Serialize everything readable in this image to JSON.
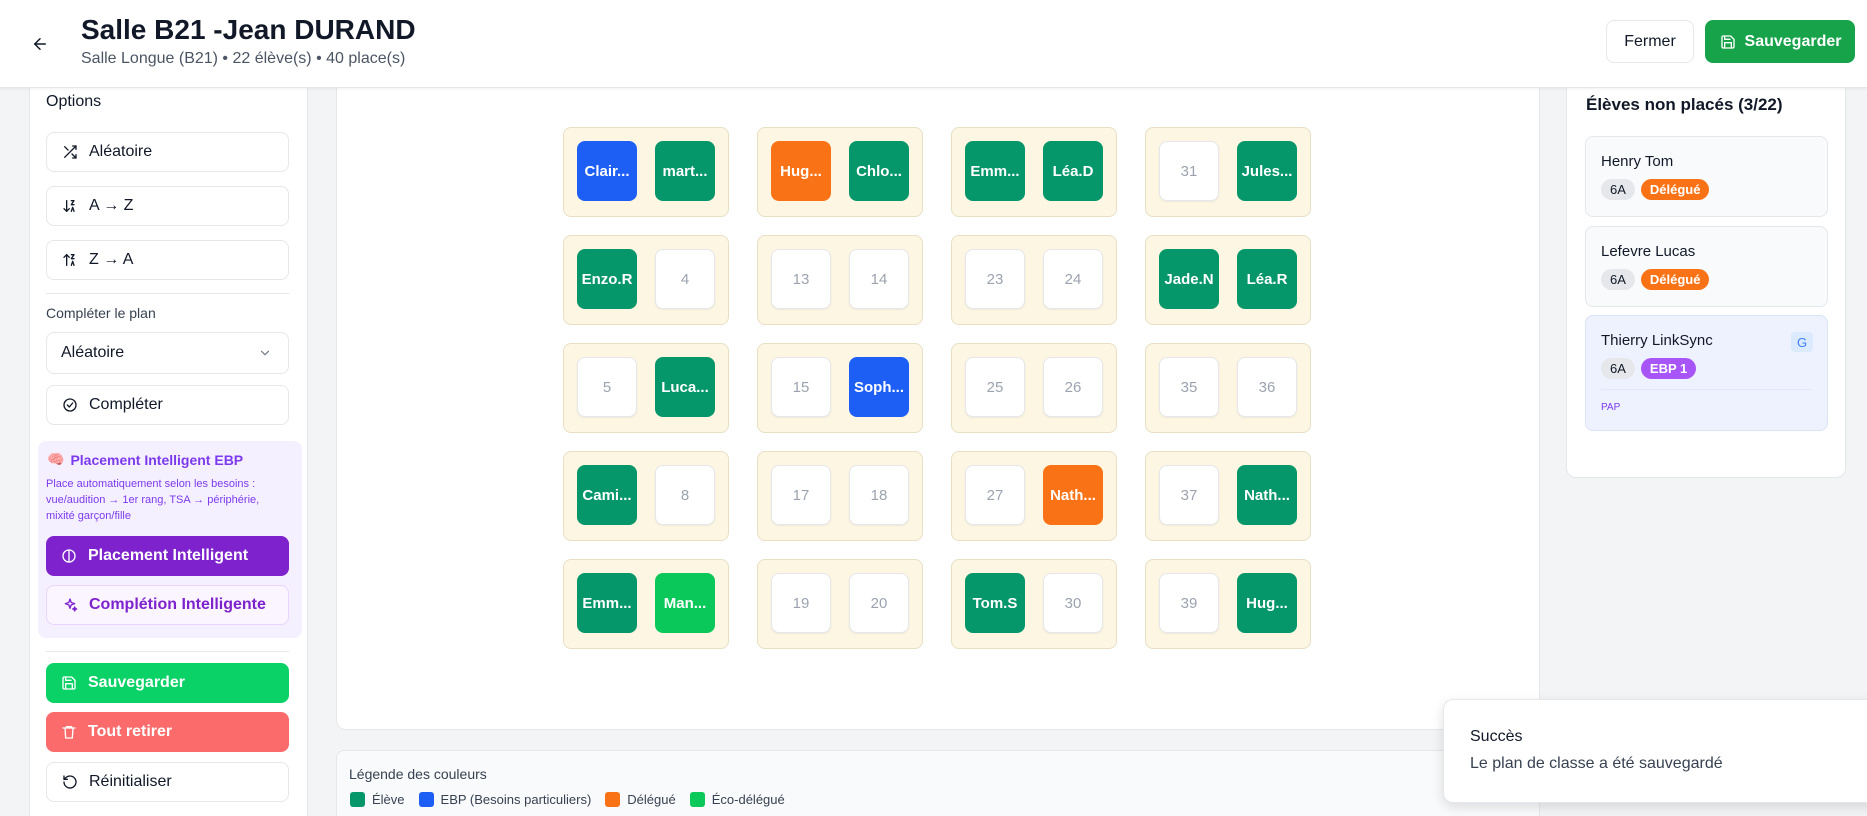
{
  "header": {
    "title": "Salle B21 -Jean DURAND",
    "subtitle": "Salle Longue (B21) • 22 élève(s) • 40 place(s)",
    "close_label": "Fermer",
    "save_label": "Sauvegarder"
  },
  "options": {
    "title": "Options",
    "random_label": "Aléatoire",
    "az_label": "A → Z",
    "za_label": "Z → A",
    "complete_section_label": "Compléter le plan",
    "complete_mode_value": "Aléatoire",
    "complete_label": "Compléter",
    "ebp": {
      "title": "Placement Intelligent EBP",
      "description": "Place automatiquement selon les besoins : vue/audition → 1er rang, TSA → périphérie, mixité garçon/fille",
      "placement_label": "Placement Intelligent",
      "completion_label": "Complétion Intelligente"
    },
    "save_label": "Sauvegarder",
    "remove_all_label": "Tout retirer",
    "reset_label": "Réinitialiser"
  },
  "colors": {
    "eleve": "#059669",
    "ebp": "#1d5ff5",
    "delegue": "#f97316",
    "eco": "#0bc85a",
    "accent": "#16a34a"
  },
  "seating": {
    "rows": [
      [
        [
          {
            "label": "Clair...",
            "type": "ebp"
          },
          {
            "label": "mart...",
            "type": "eleve"
          }
        ],
        [
          {
            "label": "Hug...",
            "type": "delegue"
          },
          {
            "label": "Chlo...",
            "type": "eleve"
          }
        ],
        [
          {
            "label": "Emm...",
            "type": "eleve"
          },
          {
            "label": "Léa.D",
            "type": "eleve"
          }
        ],
        [
          {
            "label": "31",
            "type": "empty"
          },
          {
            "label": "Jules...",
            "type": "eleve"
          }
        ]
      ],
      [
        [
          {
            "label": "Enzo.R",
            "type": "eleve"
          },
          {
            "label": "4",
            "type": "empty"
          }
        ],
        [
          {
            "label": "13",
            "type": "empty"
          },
          {
            "label": "14",
            "type": "empty"
          }
        ],
        [
          {
            "label": "23",
            "type": "empty"
          },
          {
            "label": "24",
            "type": "empty"
          }
        ],
        [
          {
            "label": "Jade.N",
            "type": "eleve"
          },
          {
            "label": "Léa.R",
            "type": "eleve"
          }
        ]
      ],
      [
        [
          {
            "label": "5",
            "type": "empty"
          },
          {
            "label": "Luca...",
            "type": "eleve"
          }
        ],
        [
          {
            "label": "15",
            "type": "empty"
          },
          {
            "label": "Soph...",
            "type": "ebp"
          }
        ],
        [
          {
            "label": "25",
            "type": "empty"
          },
          {
            "label": "26",
            "type": "empty"
          }
        ],
        [
          {
            "label": "35",
            "type": "empty"
          },
          {
            "label": "36",
            "type": "empty"
          }
        ]
      ],
      [
        [
          {
            "label": "Cami...",
            "type": "eleve"
          },
          {
            "label": "8",
            "type": "empty"
          }
        ],
        [
          {
            "label": "17",
            "type": "empty"
          },
          {
            "label": "18",
            "type": "empty"
          }
        ],
        [
          {
            "label": "27",
            "type": "empty"
          },
          {
            "label": "Nath...",
            "type": "delegue"
          }
        ],
        [
          {
            "label": "37",
            "type": "empty"
          },
          {
            "label": "Nath...",
            "type": "eleve"
          }
        ]
      ],
      [
        [
          {
            "label": "Emm...",
            "type": "eleve"
          },
          {
            "label": "Man...",
            "type": "eco"
          }
        ],
        [
          {
            "label": "19",
            "type": "empty"
          },
          {
            "label": "20",
            "type": "empty"
          }
        ],
        [
          {
            "label": "Tom.S",
            "type": "eleve"
          },
          {
            "label": "30",
            "type": "empty"
          }
        ],
        [
          {
            "label": "39",
            "type": "empty"
          },
          {
            "label": "Hug...",
            "type": "eleve"
          }
        ]
      ]
    ]
  },
  "legend": {
    "title": "Légende des couleurs",
    "items": [
      {
        "label": "Élève",
        "color": "#059669"
      },
      {
        "label": "EBP (Besoins particuliers)",
        "color": "#1d5ff5"
      },
      {
        "label": "Délégué",
        "color": "#f97316"
      },
      {
        "label": "Éco-délégué",
        "color": "#0bc85a"
      }
    ]
  },
  "unplaced": {
    "title": "Élèves non placés (3/22)",
    "students": [
      {
        "name": "Henry Tom",
        "class": "6A",
        "badge": "Délégué",
        "badge_type": "delegue"
      },
      {
        "name": "Lefevre Lucas",
        "class": "6A",
        "badge": "Délégué",
        "badge_type": "delegue"
      },
      {
        "name": "Thierry LinkSync",
        "class": "6A",
        "badge": "EBP 1",
        "badge_type": "ebp",
        "corner": "G",
        "note": "PAP"
      }
    ]
  },
  "toast": {
    "title": "Succès",
    "message": "Le plan de classe a été sauvegardé"
  }
}
